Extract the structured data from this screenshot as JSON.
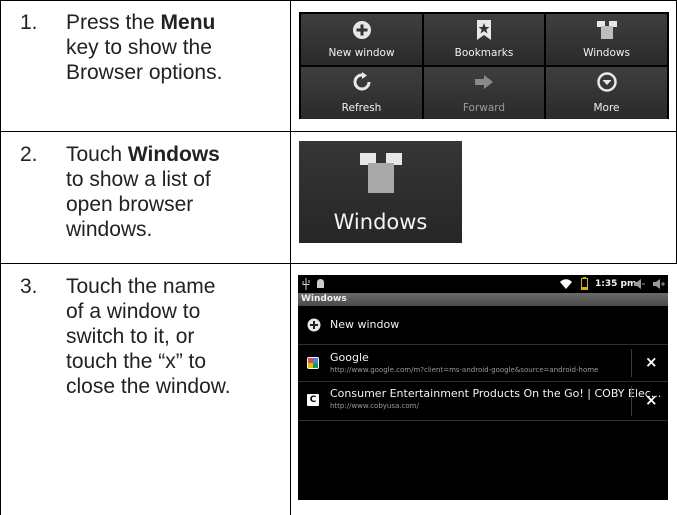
{
  "steps": [
    {
      "number": "1.",
      "lines": [
        {
          "pre": "Press the ",
          "bold": "Menu",
          "post": ""
        },
        {
          "pre": "key to show the",
          "bold": "",
          "post": ""
        },
        {
          "pre": "Browser options.",
          "bold": "",
          "post": ""
        }
      ]
    },
    {
      "number": "2.",
      "lines": [
        {
          "pre": "Touch ",
          "bold": "Windows",
          "post": ""
        },
        {
          "pre": "to show a list of",
          "bold": "",
          "post": ""
        },
        {
          "pre": "open browser",
          "bold": "",
          "post": ""
        },
        {
          "pre": "windows.",
          "bold": "",
          "post": ""
        }
      ]
    },
    {
      "number": "3.",
      "lines": [
        {
          "pre": "Touch the name",
          "bold": "",
          "post": ""
        },
        {
          "pre": "of a window to",
          "bold": "",
          "post": ""
        },
        {
          "pre": "switch to it, or",
          "bold": "",
          "post": ""
        },
        {
          "pre": "touch the “x” to",
          "bold": "",
          "post": ""
        },
        {
          "pre": "close the window.",
          "bold": "",
          "post": ""
        }
      ]
    }
  ],
  "menu": {
    "new_window": "New window",
    "bookmarks": "Bookmarks",
    "windows": "Windows",
    "refresh": "Refresh",
    "forward": "Forward",
    "more": "More"
  },
  "windows_button": {
    "label": "Windows"
  },
  "screen": {
    "status_time": "1:35 pm",
    "title": "Windows",
    "new_window": "New window",
    "tabs": [
      {
        "favicon_letter": "",
        "title": "Google",
        "url": "http://www.google.com/m?client=ms-android-google&source=android-home",
        "close": "×"
      },
      {
        "favicon_letter": "C",
        "title": "Consumer Entertainment Products On the Go! | COBY Elec...",
        "url": "http://www.cobyusa.com/",
        "close": "×"
      }
    ]
  },
  "colors": {
    "panel_bg": "#000000",
    "button_bg": "#333333",
    "text_dark": "#222222"
  }
}
